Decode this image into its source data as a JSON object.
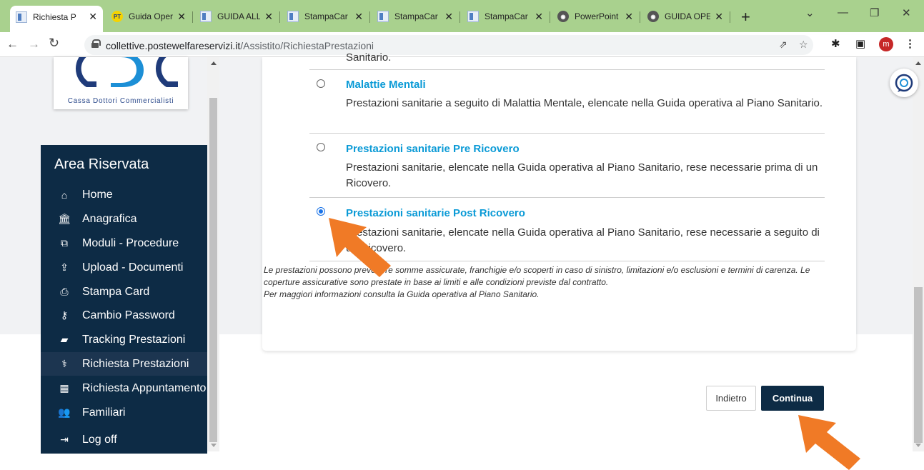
{
  "browser": {
    "tabs": [
      {
        "title": "Richiesta P",
        "icon": "document-icon",
        "active": true
      },
      {
        "title": "Guida Oper",
        "icon": "pt-icon"
      },
      {
        "title": "GUIDA ALL",
        "icon": "document-icon"
      },
      {
        "title": "StampaCar",
        "icon": "document-icon"
      },
      {
        "title": "StampaCar",
        "icon": "document-icon"
      },
      {
        "title": "StampaCar",
        "icon": "document-icon"
      },
      {
        "title": "PowerPoint",
        "icon": "globe-icon"
      },
      {
        "title": "GUIDA OPE",
        "icon": "globe-icon"
      }
    ],
    "new_tab": "+",
    "url_host": "collettive.postewelfareservizi.it",
    "url_path": "/Assistito/RichiestaPrestazioni",
    "profile_initial": "m"
  },
  "logo": {
    "text": "Cassa Dottori Commercialisti"
  },
  "sidebar": {
    "title": "Area Riservata",
    "items": [
      {
        "label": "Home",
        "icon": "home-icon"
      },
      {
        "label": "Anagrafica",
        "icon": "bank-icon"
      },
      {
        "label": "Moduli - Procedure",
        "icon": "copy-icon"
      },
      {
        "label": "Upload - Documenti",
        "icon": "upload-icon"
      },
      {
        "label": "Stampa Card",
        "icon": "print-icon"
      },
      {
        "label": "Cambio Password",
        "icon": "key-icon"
      },
      {
        "label": "Tracking Prestazioni",
        "icon": "book-icon"
      },
      {
        "label": "Richiesta Prestazioni",
        "icon": "stethoscope-icon",
        "active": true
      },
      {
        "label": "Richiesta Appuntamento",
        "icon": "calendar-icon"
      },
      {
        "label": "Familiari",
        "icon": "users-icon"
      },
      {
        "label": "Log off",
        "icon": "logout-icon"
      }
    ]
  },
  "main": {
    "top_cut_text": "Sanitario.",
    "options": [
      {
        "title": "Malattie Mentali",
        "description": "Prestazioni sanitarie a seguito di Malattia Mentale, elencate nella Guida operativa al Piano Sanitario.",
        "selected": false
      },
      {
        "title": "Prestazioni sanitarie Pre Ricovero",
        "description": "Prestazioni sanitarie, elencate nella Guida operativa al Piano Sanitario, rese necessarie prima di un Ricovero.",
        "selected": false
      },
      {
        "title": "Prestazioni sanitarie Post Ricovero",
        "description": "Prestazioni sanitarie, elencate nella Guida operativa al Piano Sanitario, rese necessarie a seguito di un Ricovero.",
        "selected": true
      }
    ],
    "note_line1": "Le prestazioni possono prevedere somme assicurate, franchigie e/o scoperti in caso di sinistro, limitazioni e/o esclusioni e termini di carenza. Le coperture assicurative sono prestate in base ai limiti e alle condizioni previste dal contratto.",
    "note_line2": "Per maggiori informazioni consulta la Guida operativa al Piano Sanitario.",
    "back_label": "Indietro",
    "continue_label": "Continua"
  },
  "colors": {
    "sidebar_bg": "#0d2b45",
    "accent": "#0a9ad6",
    "arrow": "#f07a26",
    "tabstrip": "#a9d18e"
  }
}
